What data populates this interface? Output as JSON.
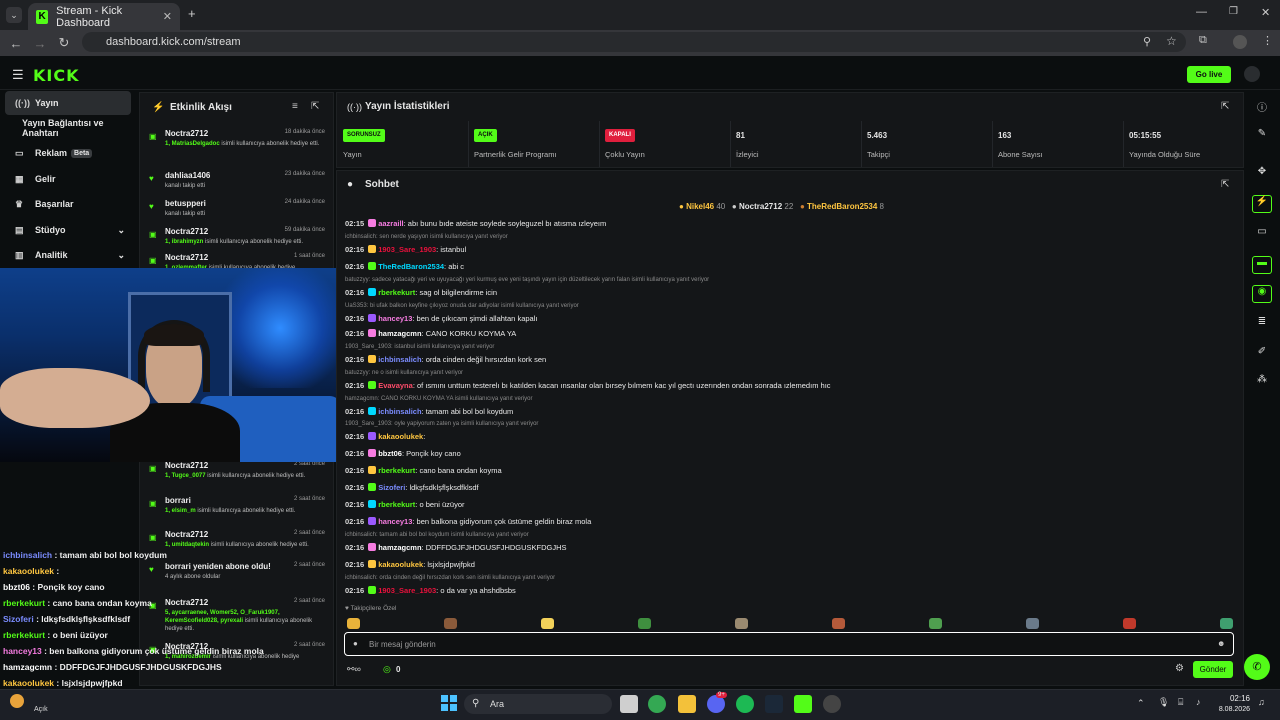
{
  "browser": {
    "tab_title": "Stream - Kick Dashboard",
    "url": "dashboard.kick.com/stream"
  },
  "header": {
    "logo": "KICK",
    "go_live": "Go live"
  },
  "sidebar": {
    "items": [
      {
        "label": "Yayın",
        "icon": "radio-icon"
      },
      {
        "label": "Yayın Bağlantısı ve Anahtarı",
        "icon": ""
      },
      {
        "label": "Reklam",
        "icon": "tv-icon",
        "badge": "Beta"
      },
      {
        "label": "Gelir",
        "icon": "chart-icon"
      },
      {
        "label": "Başarılar",
        "icon": "trophy-icon"
      },
      {
        "label": "Stüdyo",
        "icon": "studio-icon"
      },
      {
        "label": "Analitik",
        "icon": "analytics-icon"
      }
    ]
  },
  "events": {
    "title": "Etkinlik Akışı",
    "items": [
      {
        "name": "Noctra2712",
        "time": "18 dakika önce",
        "highlight": "1, MatriasDelgadoc",
        "desc": " isimli kullanıcıya abonelik hediye etti."
      },
      {
        "name": "dahliaa1406",
        "time": "23 dakika önce",
        "highlight": "",
        "desc": "kanalı takip etti"
      },
      {
        "name": "betuspperi",
        "time": "24 dakika önce",
        "highlight": "",
        "desc": "kanalı takip etti"
      },
      {
        "name": "Noctra2712",
        "time": "59 dakika önce",
        "highlight": "1, ibrahimyzn",
        "desc": " isimli kullanıcıya abonelik hediye etti."
      },
      {
        "name": "Noctra2712",
        "time": "1 saat önce",
        "highlight": "1, ozlemmafter",
        "desc": " isimli kullanıcıya abonelik hediye"
      },
      {
        "name": "Noctra2712",
        "time": "2 saat önce",
        "highlight": "1, Tugce_0077",
        "desc": " isimli kullanıcıya abonelik hediye etti."
      },
      {
        "name": "borrari",
        "time": "2 saat önce",
        "highlight": "1, elsim_m",
        "desc": " isimli kullanıcıya abonelik hediye etti."
      },
      {
        "name": "Noctra2712",
        "time": "2 saat önce",
        "highlight": "1, umitdaqtekin",
        "desc": " isimli kullanıcıya abonelik hediye etti."
      },
      {
        "name": "borrari yeniden abone oldu!",
        "time": "2 saat önce",
        "highlight": "",
        "desc": "4 aylık abone oldular"
      },
      {
        "name": "Noctra2712",
        "time": "2 saat önce",
        "highlight": "5, aycarraenee, Womer52, O_Faruk1907, KeremScofield028, pyrexali",
        "desc": " isimli kullanıcıya abonelik hediye etti."
      },
      {
        "name": "Noctra2712",
        "time": "2 saat önce",
        "highlight": "1, mahirozdemir",
        "desc": " isimli kullanıcıya abonelik hediye"
      }
    ]
  },
  "stats": {
    "title": "Yayın İstatistikleri",
    "items": [
      {
        "pill": "SORUNSUZ",
        "pill_color": "#53fc18",
        "label": "Yayın"
      },
      {
        "pill": "AÇIK",
        "pill_color": "#53fc18",
        "label": "Partnerlik Gelir Programı"
      },
      {
        "pill": "KAPALI",
        "pill_color": "#e01f3d",
        "label": "Çoklu Yayın"
      },
      {
        "value": "81",
        "label": "İzleyici"
      },
      {
        "value": "5.463",
        "label": "Takipçi"
      },
      {
        "value": "163",
        "label": "Abone Sayısı"
      },
      {
        "value": "05:15:55",
        "label": "Yayında Olduğu Süre"
      }
    ]
  },
  "chat": {
    "title": "Sohbet",
    "leaders": [
      {
        "name": "Nikel46",
        "count": "40"
      },
      {
        "name": "Noctra2712",
        "count": "22"
      },
      {
        "name": "TheRedBaron2534",
        "count": "8"
      }
    ],
    "input_placeholder": "Bir mesaj gönderin",
    "send": "Gönder",
    "counter": "0",
    "emote_section": "Takipçilere Özel",
    "messages": [
      {
        "reply": "",
        "time": "02:15",
        "user": "aazraill",
        "color": "#f67ce1",
        "text": ": abı bunu bıde ateiste soylede soyleguzel bı atısma ızleyeım"
      },
      {
        "reply": "ichbinsalich: sen nerde yaşıyon isimli kullanıcıya yanıt veriyor",
        "time": "02:16",
        "user": "1903_Sare_1903",
        "color": "#e9113c",
        "text": ": istanbul"
      },
      {
        "reply": "",
        "time": "02:16",
        "user": "TheRedBaron2534",
        "color": "#00d8ff",
        "text": ": abi c"
      },
      {
        "reply": "batuzzyy: sadece yatacağı yeri ve uyuyacağı yeri kurmuş eve yeni taşındı yayın için düzeltilecek yarın falan isimli kullanıcıya yanıt veriyor",
        "time": "02:16",
        "user": "rberkekurt",
        "color": "#53fc18",
        "text": ": sag ol bilgilendirme icin"
      },
      {
        "reply": "UaS353: bi ufak balkon keyfine çıkıyoz onuda dar adiyolar isimli kullanıcıya yanıt veriyor",
        "time": "02:16",
        "user": "hancey13",
        "color": "#f67ce1",
        "text": ": ben de çıkıcam şimdi allahtan kapalı"
      },
      {
        "reply": "",
        "time": "02:16",
        "user": "hamzagcmn",
        "color": "#ffffff",
        "text": ": CANO KORKU KOYMA YA"
      },
      {
        "reply": "1903_Sare_1903: istanbul isimli kullanıcıya yanıt veriyor",
        "time": "02:16",
        "user": "ichbinsalich",
        "color": "#7b8cff",
        "text": ": orda cinden değil hırsızdan kork sen"
      },
      {
        "reply": "batuzzyy: ne o isimli kullanıcıya yanıt veriyor",
        "time": "02:16",
        "user": "Evavayna",
        "color": "#ff4c6a",
        "text": ": of ısmını unttum testerelı bı katılden kacan ınsanlar olan bırsey bılmem kac yıl gectı uzerınden ondan sonrada ızlemedım hıc"
      },
      {
        "reply": "hamzagcmn: CANO KORKU KOYMA YA isimli kullanıcıya yanıt veriyor",
        "time": "02:16",
        "user": "ichbinsalich",
        "color": "#7b8cff",
        "text": ": tamam abi bol bol koydum"
      },
      {
        "reply": "1903_Sare_1903: oyle yapiyorum zaten ya isimli kullanıcıya yanıt veriyor",
        "time": "02:16",
        "user": "kakaoolukek",
        "color": "#ffc640",
        "text": ":"
      },
      {
        "reply": "",
        "time": "02:16",
        "user": "bbzt06",
        "color": "#ffffff",
        "text": ": Ponçik koy cano"
      },
      {
        "reply": "",
        "time": "02:16",
        "user": "rberkekurt",
        "color": "#53fc18",
        "text": ": cano bana ondan koyma"
      },
      {
        "reply": "",
        "time": "02:16",
        "user": "Sizoferi",
        "color": "#7b8cff",
        "text": ": ldkşfsdklşflşksdfklsdf"
      },
      {
        "reply": "",
        "time": "02:16",
        "user": "rberkekurt",
        "color": "#53fc18",
        "text": ": o beni üzüyor"
      },
      {
        "reply": "",
        "time": "02:16",
        "user": "hancey13",
        "color": "#f67ce1",
        "text": ": ben balkona gidiyorum çok üstüme geldin biraz mola"
      },
      {
        "reply": "ichbinsalich: tamam abi bol bol koydum isimli kullanıcıya yanıt veriyor",
        "time": "02:16",
        "user": "hamzagcmn",
        "color": "#ffffff",
        "text": ": DDFFDGJFJHDGUSFJHDGUSKFDGJHS"
      },
      {
        "reply": "",
        "time": "02:16",
        "user": "kakaoolukek",
        "color": "#ffc640",
        "text": ": lsjxlsjdpwjfpkd"
      },
      {
        "reply": "ichbinsalich: orda cinden değil hırsızdan kork sen isimli kullanıcıya yanıt veriyor",
        "time": "02:16",
        "user": "1903_Sare_1903",
        "color": "#e9113c",
        "text": ": o da var ya ahshdbsbs"
      }
    ]
  },
  "overlay_chat": [
    {
      "user": "ichbinsalich",
      "color": "#7b8cff",
      "text": " : tamam abi bol bol koydum"
    },
    {
      "user": "kakaoolukek",
      "color": "#ffc640",
      "text": " :"
    },
    {
      "user": "bbzt06",
      "color": "#ffffff",
      "text": " : Ponçik koy cano"
    },
    {
      "user": "rberkekurt",
      "color": "#53fc18",
      "text": " : cano bana ondan koyma"
    },
    {
      "user": "Sizoferi",
      "color": "#7b8cff",
      "text": " : ldkşfsdklşflşksdfklsdf"
    },
    {
      "user": "rberkekurt",
      "color": "#53fc18",
      "text": " : o beni üzüyor"
    },
    {
      "user": "hancey13",
      "color": "#f67ce1",
      "text": " : ben balkona gidiyorum çok üstüme geldin biraz mola"
    },
    {
      "user": "hamzagcmn",
      "color": "#ffffff",
      "text": " : DDFFDGJFJHDGUSFJHDGUSKFDGJHS"
    },
    {
      "user": "kakaoolukek",
      "color": "#ffc640",
      "text": " : lsjxlsjdpwjfpkd"
    },
    {
      "user": "1903_Sare_1903",
      "color": "#e9113c",
      "text": " : o da var ya ahshdbsbs"
    }
  ],
  "taskbar": {
    "weather": "Açık",
    "search": "Ara",
    "time": "02:16",
    "date": "8.08.2026",
    "badge": "9+"
  },
  "colors": {
    "accent": "#53fc18",
    "panel": "#141618",
    "bg": "#0b0e0f"
  }
}
